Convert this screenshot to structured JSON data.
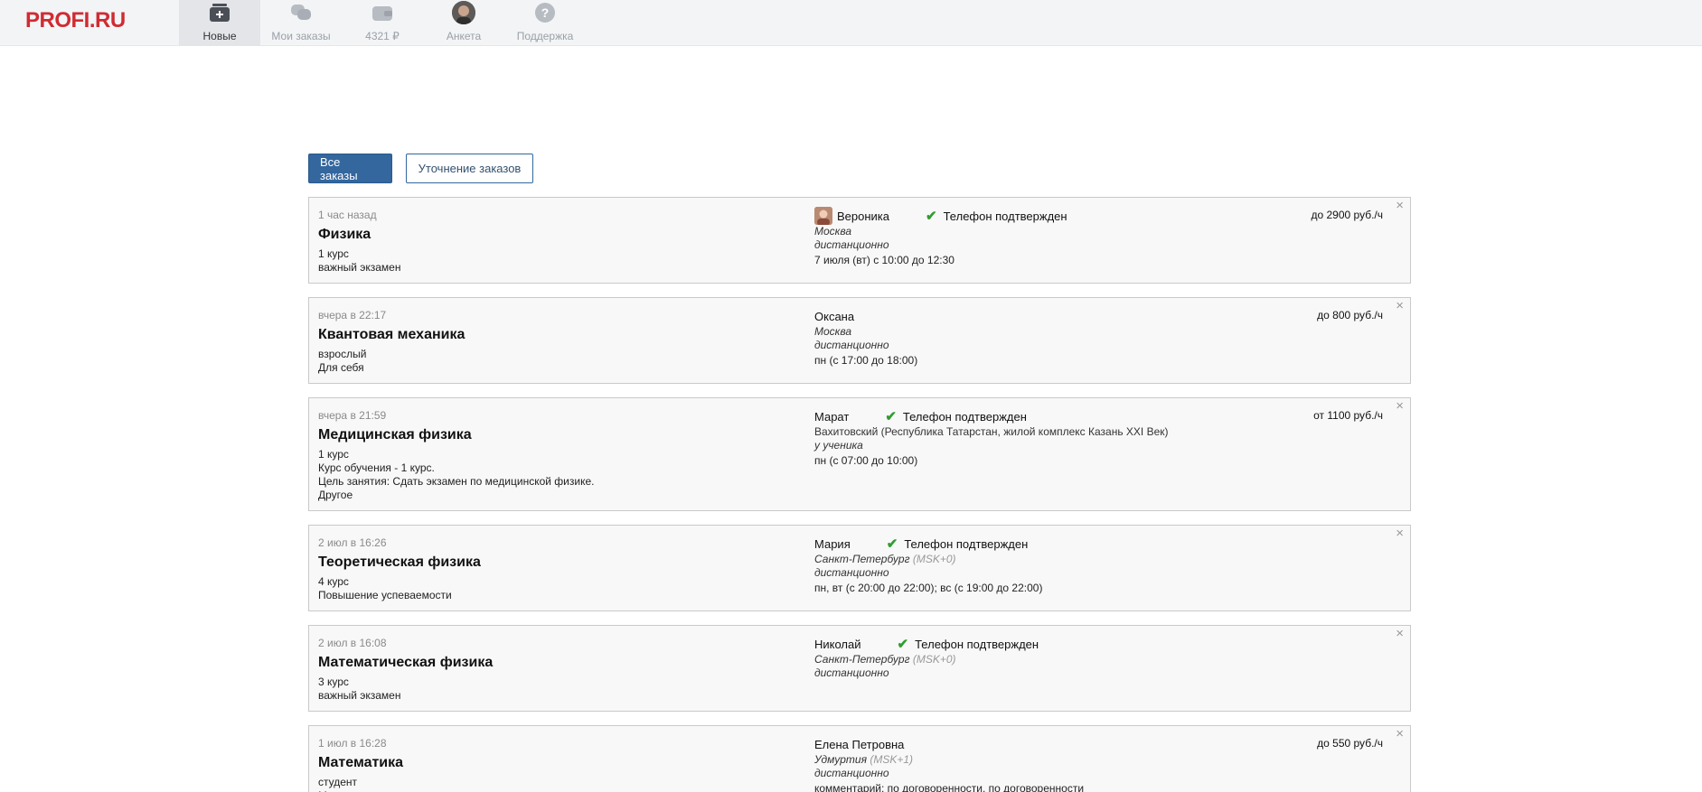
{
  "header": {
    "logo": "PROFI.RU",
    "nav": [
      {
        "label": "Новые",
        "icon": "new-orders-icon",
        "active": true
      },
      {
        "label": "Мои заказы",
        "icon": "chat-bubbles-icon",
        "active": false
      },
      {
        "label": "4321 ₽",
        "icon": "wallet-icon",
        "active": false
      },
      {
        "label": "Анкета",
        "icon": "profile-avatar-icon",
        "active": false
      },
      {
        "label": "Поддержка",
        "icon": "help-icon",
        "active": false
      }
    ]
  },
  "tabs": {
    "all_orders": "Все заказы",
    "clarification": "Уточнение заказов"
  },
  "orders": [
    {
      "time": "1 час назад",
      "title": "Физика",
      "details": [
        "1 курс",
        "важный экзамен"
      ],
      "client": "Вероника",
      "verified": "Телефон подтвержден",
      "location": "Москва",
      "location_tz": "",
      "format": "дистанционно",
      "schedule": "7 июля (вт) с 10:00 до 12:30",
      "price": "до 2900 руб./ч"
    },
    {
      "time": "вчера в 22:17",
      "title": "Квантовая механика",
      "details": [
        "взрослый",
        "Для себя"
      ],
      "client": "Оксана",
      "verified": "",
      "location": "Москва",
      "location_tz": "",
      "format": "дистанционно",
      "schedule": "пн (с 17:00 до 18:00)",
      "price": "до 800 руб./ч"
    },
    {
      "time": "вчера в 21:59",
      "title": "Медицинская физика",
      "details": [
        "1 курс",
        "Курс обучения - 1 курс.",
        "Цель занятия: Сдать экзамен по медицинской физике.",
        "Другое"
      ],
      "client": "Марат",
      "verified": "Телефон подтвержден",
      "location_plain": "Вахитовский (Республика Татарстан, жилой комплекс Казань XXI Век)",
      "format": "у ученика",
      "schedule": "пн (с 07:00 до 10:00)",
      "price": "от 1100 руб./ч"
    },
    {
      "time": "2 июл в 16:26",
      "title": "Теоретическая физика",
      "details": [
        "4 курс",
        "Повышение успеваемости"
      ],
      "client": "Мария",
      "verified": "Телефон подтвержден",
      "location": "Санкт-Петербург",
      "location_tz": "(MSK+0)",
      "format": "дистанционно",
      "schedule": "пн, вт (с 20:00 до 22:00); вс (с 19:00 до 22:00)",
      "price": ""
    },
    {
      "time": "2 июл в 16:08",
      "title": "Математическая физика",
      "details": [
        "3 курс",
        "важный экзамен"
      ],
      "client": "Николай",
      "verified": "Телефон подтвержден",
      "location": "Санкт-Петербург",
      "location_tz": "(MSK+0)",
      "format": "дистанционно",
      "schedule": "",
      "price": ""
    },
    {
      "time": "1 июл в 16:28",
      "title": "Математика",
      "details": [
        "студент",
        "М"
      ],
      "client": "Елена Петровна",
      "verified": "",
      "location": "Удмуртия",
      "location_tz": "(MSK+1)",
      "format": "дистанционно",
      "schedule": "комментарий: по договоренности, по договоренности",
      "price": "до 550 руб./ч"
    }
  ],
  "close_glyph": "×",
  "check_glyph": "✔"
}
